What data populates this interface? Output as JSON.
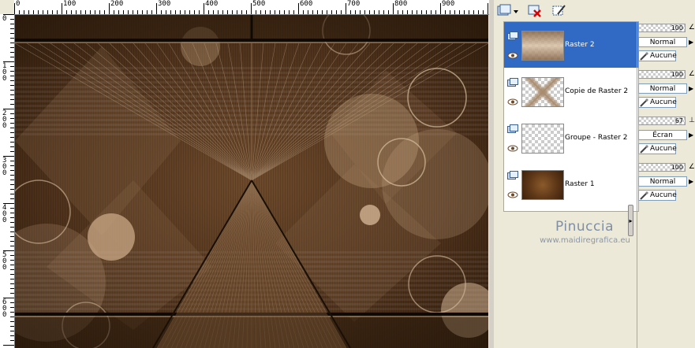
{
  "ruler": {
    "top_labels": [
      "0",
      "100",
      "200",
      "300",
      "400",
      "500",
      "600",
      "700",
      "800",
      "900"
    ],
    "left_labels": [
      "0",
      "1\n0\n0",
      "2\n0\n0",
      "3\n0\n0",
      "4\n0\n0",
      "5\n0\n0",
      "6\n0\n0"
    ]
  },
  "toolbar": {
    "new_layer_icon": "new-layer-icon",
    "delete_icon": "delete-layer-icon",
    "edit_icon": "edit-layer-icon"
  },
  "layers": [
    {
      "name": "Raster 2",
      "selected": true,
      "opacity": "100",
      "blend": "Normal",
      "mask": "Aucune"
    },
    {
      "name": "Copie de Raster 2",
      "selected": false,
      "opacity": "100",
      "blend": "Normal",
      "mask": "Aucune"
    },
    {
      "name": "Groupe - Raster 2",
      "selected": false,
      "opacity": "67",
      "blend": "Écran",
      "mask": "Aucune"
    },
    {
      "name": "Raster 1",
      "selected": false,
      "opacity": "100",
      "blend": "Normal",
      "mask": "Aucune"
    }
  ],
  "watermark": {
    "line1": "Pinuccia",
    "line2": "www.maidiregrafica.eu"
  },
  "colors": {
    "selection": "#316ac5",
    "canvas_dark": "#3b2410",
    "canvas_light": "#c9a886"
  }
}
